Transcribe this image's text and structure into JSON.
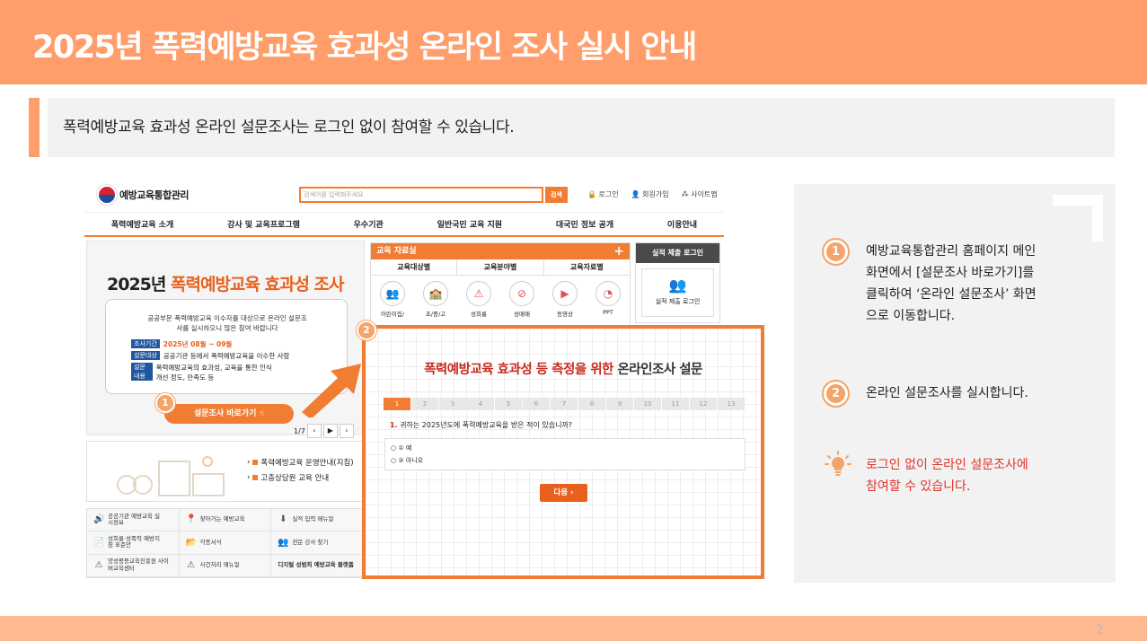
{
  "header": {
    "title": "2025년 폭력예방교육 효과성 온라인 조사 실시 안내"
  },
  "notice": {
    "text": "폭력예방교육 효과성 온라인 설문조사는 로그인 없이 참여할 수 있습니다."
  },
  "site": {
    "logo": "예방교육통합관리",
    "search_placeholder": "검색어를 입력해주세요",
    "search_button": "검색",
    "util": [
      "로그인",
      "회원가입",
      "사이트맵"
    ],
    "nav": [
      "폭력예방교육 소개",
      "강사 및 교육프로그램",
      "우수기관",
      "일반국민 교육 지원",
      "대국민 정보 공개",
      "이용안내"
    ],
    "hero": {
      "title_year": "2025년",
      "title_main": "폭력예방교육 효과성 조사",
      "desc": "공공부문 폭력예방교육 이수자를 대상으로 온라인 설문조사를 실시하오니 많은 참여 바랍니다",
      "rows": [
        {
          "tag": "조사기간",
          "text": "2025년 08월 ~ 09월"
        },
        {
          "tag": "설문대상",
          "text": "공공기관 등에서 폭력예방교육을 이수한 사람"
        },
        {
          "tag": "설문내용",
          "text": "폭력예방교육의 효과성, 교육을 통한 인식개선 정도, 만족도 등"
        }
      ],
      "button": "설문조사 바로가기",
      "page": "1/7"
    },
    "edu": {
      "title": "교육 자료실",
      "tabs": [
        "교육대상별",
        "교육분야별",
        "교육자료별"
      ],
      "icons": [
        "어린이집/",
        "초/중/고",
        "성희롱",
        "성매매",
        "동영상",
        "PPT"
      ]
    },
    "login": {
      "title": "실적 제출 로그인",
      "label": "실적 제출 로그인"
    },
    "banner": {
      "links": [
        "폭력예방교육 운영안내(지침)",
        "고충상담원 교육 안내"
      ]
    },
    "quick": [
      "공공기관 예방교육 실시정보",
      "찾아가는 예방교육",
      "실적 입력 매뉴얼",
      "성희롱·성폭력 예방지침 표준안",
      "각종서식",
      "전문 강사 찾기",
      "양성평등교육진흥원 사이버교육센터",
      "사건처리 매뉴얼",
      "디지털 성범죄 예방교육 플랫폼"
    ]
  },
  "popup": {
    "title_red": "폭력예방교육 효과성 등 측정을 위한",
    "title_dark": "온라인조사 설문",
    "steps": [
      "1",
      "2",
      "3",
      "4",
      "5",
      "6",
      "7",
      "8",
      "9",
      "10",
      "11",
      "12",
      "13"
    ],
    "question_no": "1.",
    "question": "귀하는 2025년도에 폭력예방교육을 받은 적이 있습니까?",
    "options": [
      "① 예",
      "② 아니오"
    ],
    "next": "다음"
  },
  "badges": {
    "one": "1",
    "two": "2"
  },
  "panel": {
    "step1": [
      "예방교육통합관리 홈페이지 메인",
      "화면에서 [설문조사 바로가기]를",
      "클릭하여 ‘온라인 설문조사’ 화면",
      "으로 이동합니다."
    ],
    "step2": "온라인 설문조사를 실시합니다.",
    "tip": [
      "로그인 없이 온라인 설문조사에",
      "참여할 수 있습니다."
    ]
  },
  "footer": {
    "page": "2"
  },
  "colors": {
    "accent": "#FF9E6B",
    "orange": "#F07D32",
    "red": "#E0352B"
  }
}
